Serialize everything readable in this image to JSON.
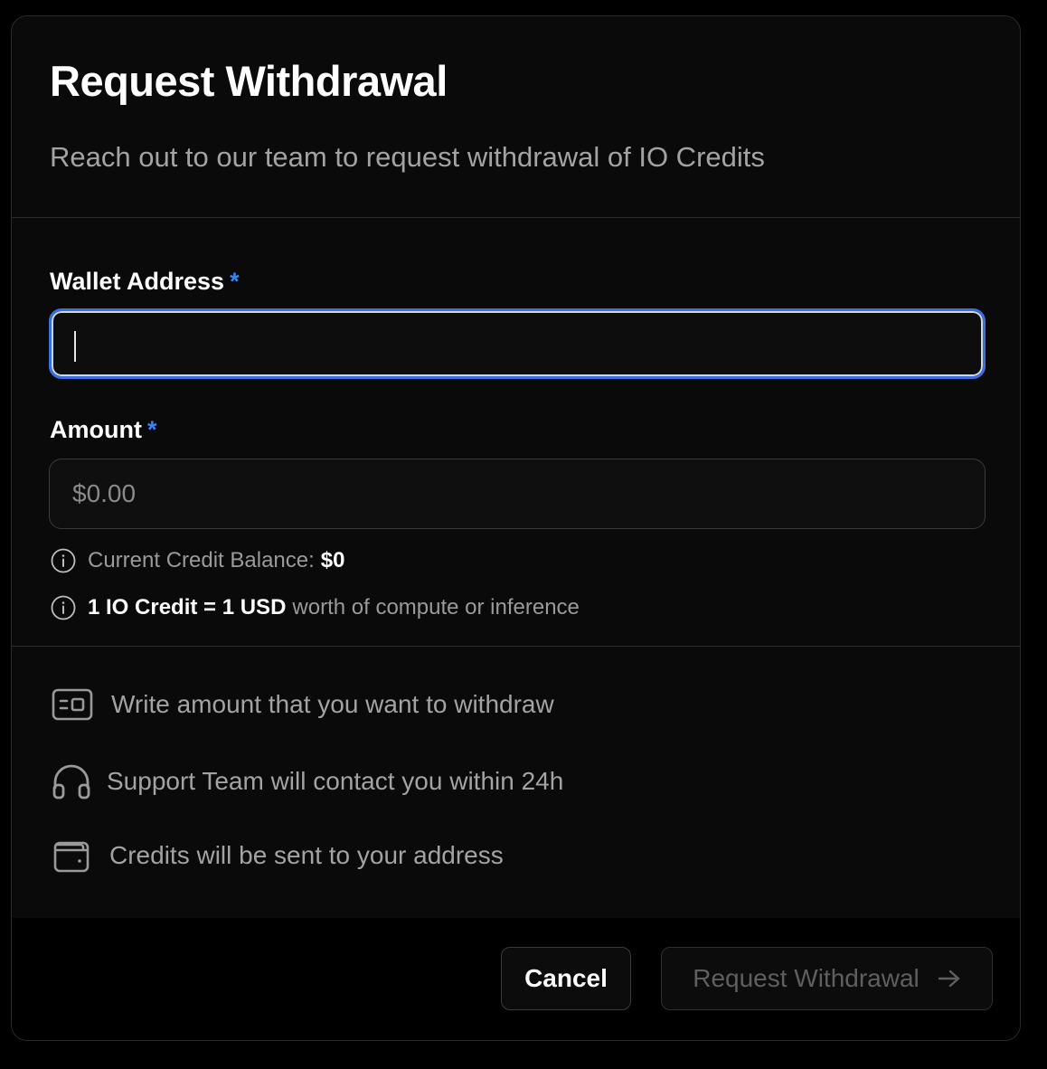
{
  "dialog": {
    "title": "Request Withdrawal",
    "subtitle": "Reach out to our team to request withdrawal of IO Credits"
  },
  "form": {
    "wallet": {
      "label": "Wallet Address",
      "required_mark": "*",
      "value": "",
      "placeholder": ""
    },
    "amount": {
      "label": "Amount",
      "required_mark": "*",
      "value": "",
      "placeholder": "$0.00"
    },
    "balance_info": {
      "icon": "info-icon",
      "label": "Current Credit Balance:",
      "value": "$0"
    },
    "rate_info": {
      "icon": "info-icon",
      "highlight": "1 IO Credit = 1 USD",
      "text": "worth of compute or inference"
    }
  },
  "steps": [
    {
      "icon": "id-card-icon",
      "text": "Write amount that you want to withdraw"
    },
    {
      "icon": "headphones-icon",
      "text": "Support Team will contact you within 24h"
    },
    {
      "icon": "wallet-icon",
      "text": "Credits will be sent to your address"
    }
  ],
  "footer": {
    "cancel_label": "Cancel",
    "submit_label": "Request Withdrawal",
    "submit_icon": "arrow-right-icon"
  },
  "colors": {
    "accent": "#3b82f6",
    "focus_ring": "#3b6fe0",
    "background": "#0a0a0a",
    "muted_text": "#a3a3a3"
  }
}
